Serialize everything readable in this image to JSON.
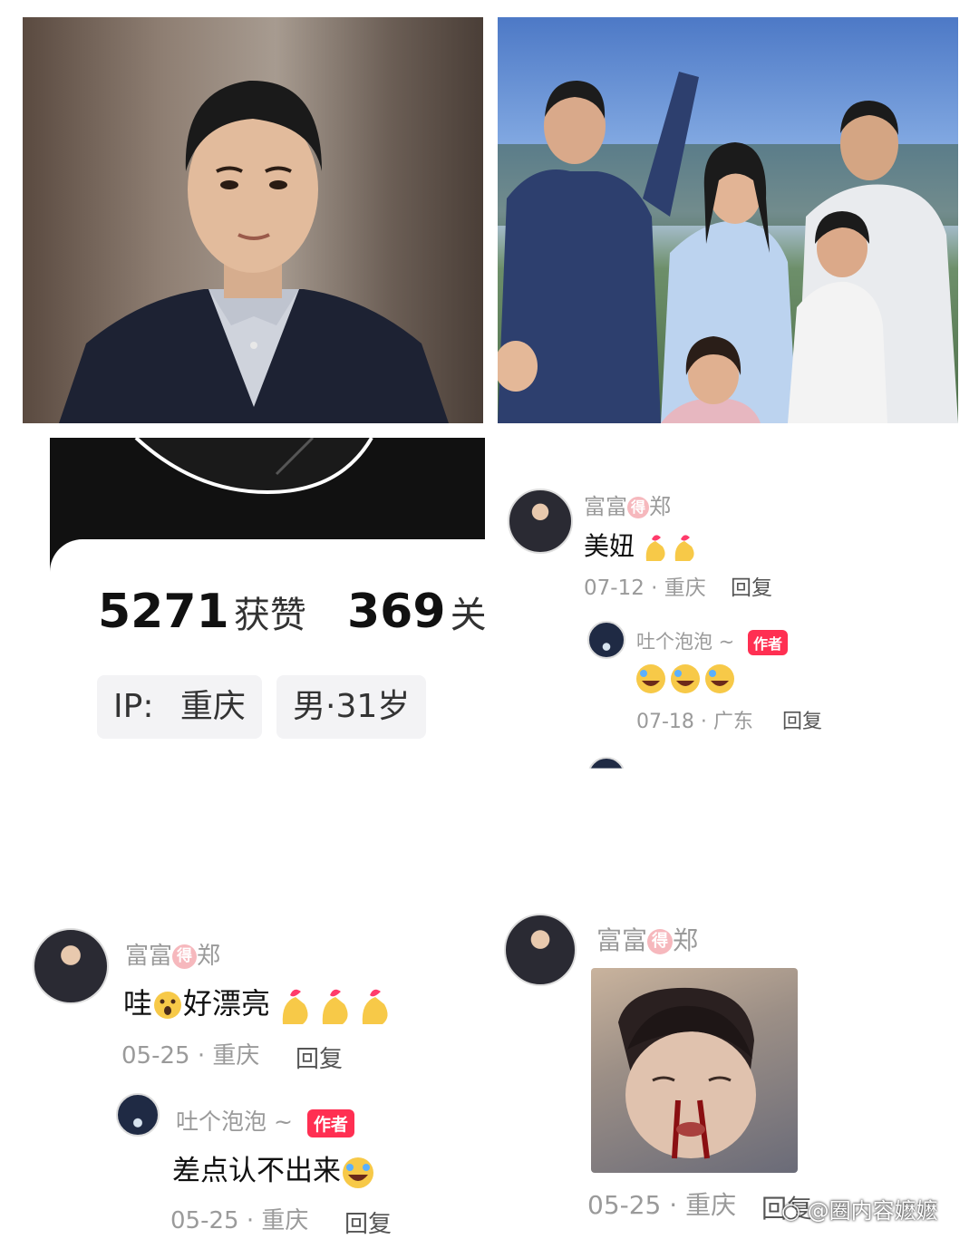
{
  "profile": {
    "likes_count": "5271",
    "likes_label": "获赞",
    "following_count": "369",
    "following_label": "关",
    "ip_label": "IP:",
    "ip_location": "重庆",
    "gender_age": "男·31岁"
  },
  "comment_top_right": {
    "username_a": "富富",
    "username_badge": "得",
    "username_b": "郑",
    "text": "美妞",
    "emoji": "finger-heart-emoji x2",
    "date": "07-12",
    "location": "重庆",
    "reply_label": "回复",
    "reply": {
      "username": "吐个泡泡 ~",
      "author_tag": "作者",
      "emoji": "rofl-emoji x3",
      "date": "07-18",
      "location": "广东",
      "reply_label": "回复"
    }
  },
  "comment_bottom_left": {
    "username_a": "富富",
    "username_badge": "得",
    "username_b": "郑",
    "text_a": "哇",
    "text_b": "好漂亮",
    "emoji": "surprised-emoji, finger-heart-emoji x3",
    "date": "05-25",
    "location": "重庆",
    "reply_label": "回复",
    "reply": {
      "username": "吐个泡泡 ~",
      "author_tag": "作者",
      "text": "差点认不出来",
      "emoji": "rofl-emoji",
      "date": "05-25",
      "location": "重庆",
      "reply_label": "回复"
    }
  },
  "comment_bottom_right": {
    "username_a": "富富",
    "username_badge": "得",
    "username_b": "郑",
    "date": "05-25",
    "location": "重庆",
    "reply_label": "回复"
  },
  "watermark": "@圈内容嬷嬷",
  "colors": {
    "author_badge": "#ff2f52",
    "meta_text": "#9a9a9a",
    "finger_heart": "#f7c948",
    "heart": "#ff3b6b"
  }
}
